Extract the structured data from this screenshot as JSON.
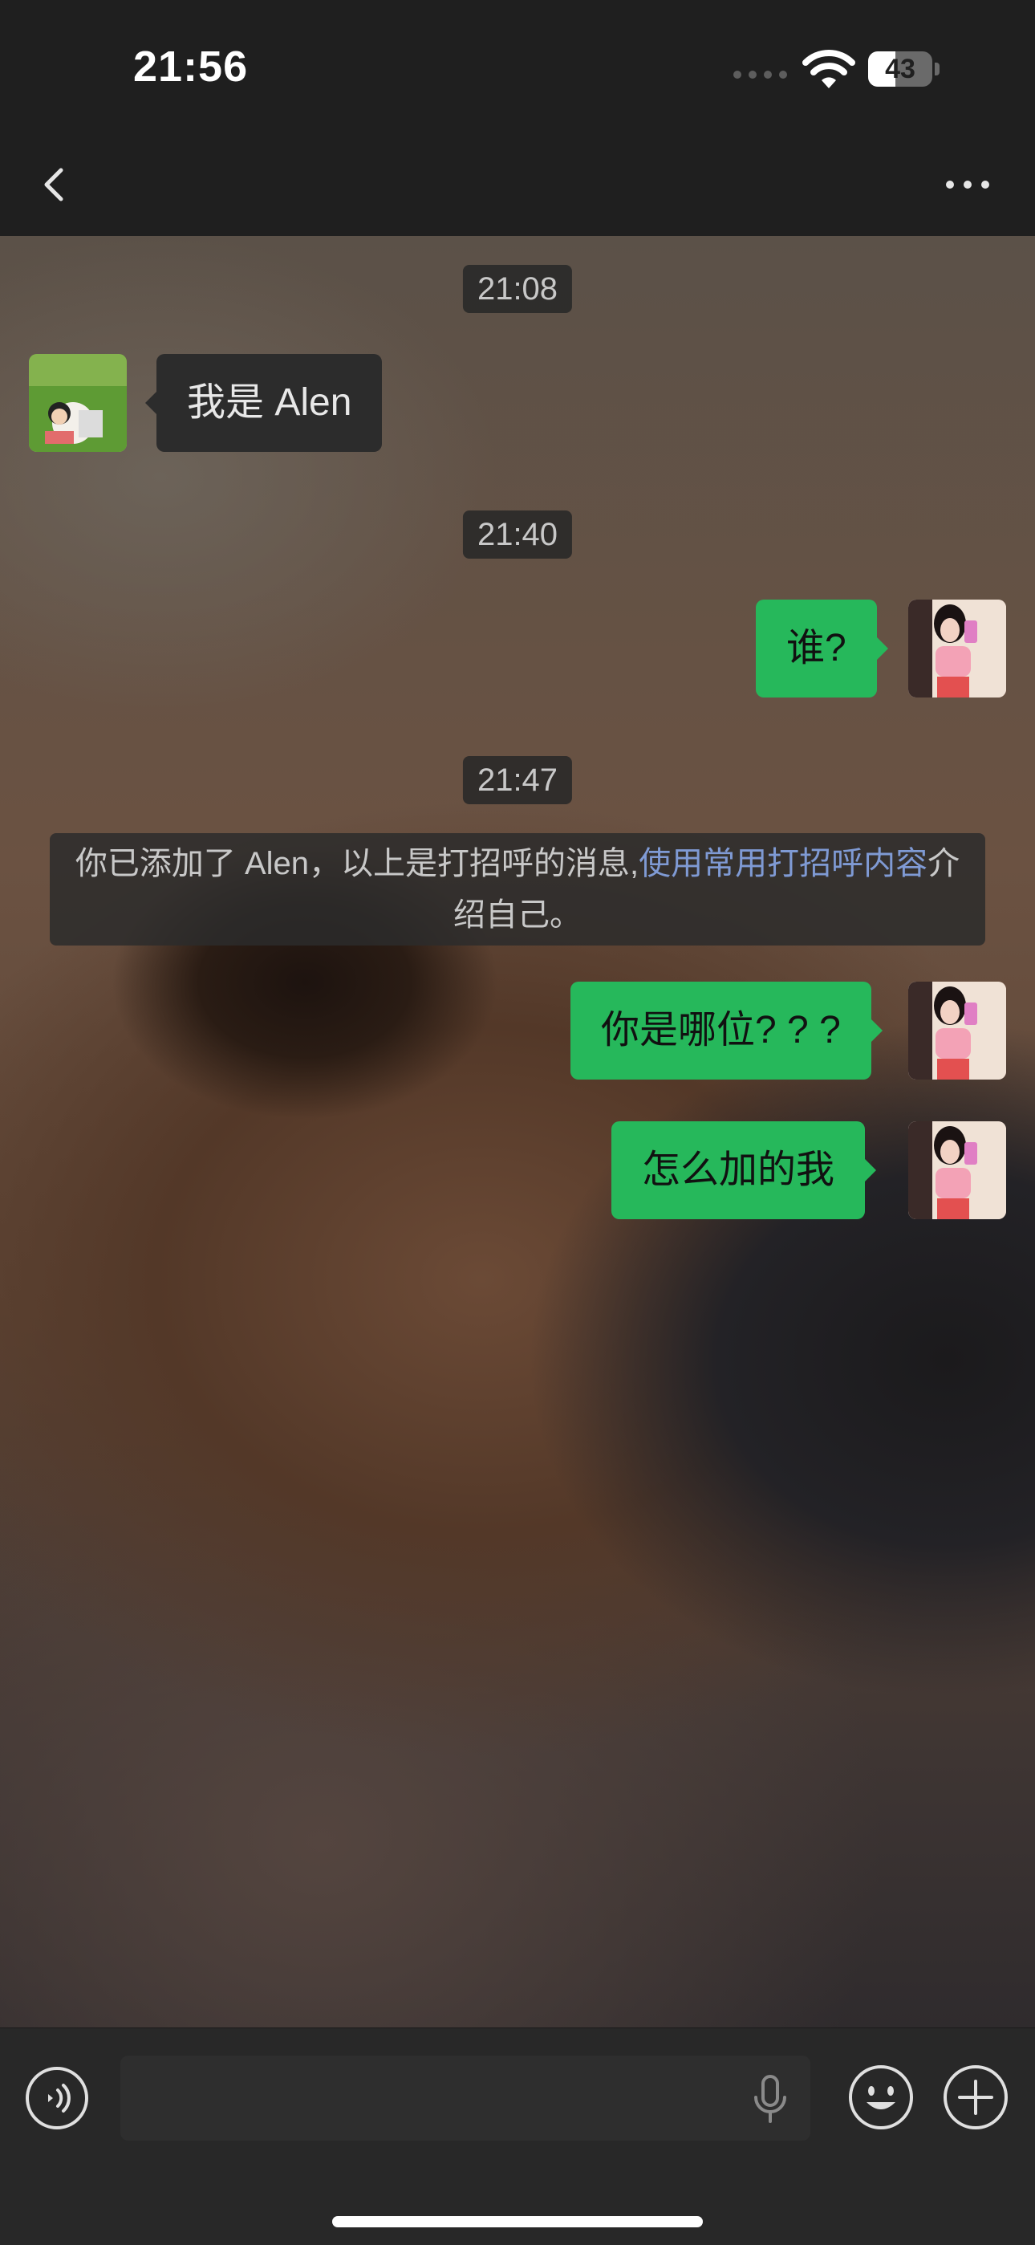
{
  "status_bar": {
    "time": "21:56",
    "battery_level": "43",
    "battery_fraction": 0.43
  },
  "nav": {
    "back_icon": "chevron-left-icon",
    "more_icon": "more-horizontal-icon"
  },
  "messages": {
    "timestamp_1": "21:08",
    "incoming_1": "我是 Alen",
    "timestamp_2": "21:40",
    "outgoing_1": "谁?",
    "timestamp_3": "21:47",
    "system_text": "你已添加了 Alen，以上是打招呼的消息,",
    "system_link": "使用常用打招呼内容",
    "system_suffix": "介绍自己。",
    "outgoing_2": "你是哪位? ? ?",
    "outgoing_3": "怎么加的我"
  },
  "input_bar": {
    "voice_icon": "voice-mode-icon",
    "mic_icon": "microphone-icon",
    "emoji_icon": "emoji-icon",
    "plus_icon": "plus-icon",
    "input_value": ""
  },
  "colors": {
    "accent_green": "#26b85b",
    "link_blue": "#7f9ad4",
    "background": "#1f1f1f"
  }
}
